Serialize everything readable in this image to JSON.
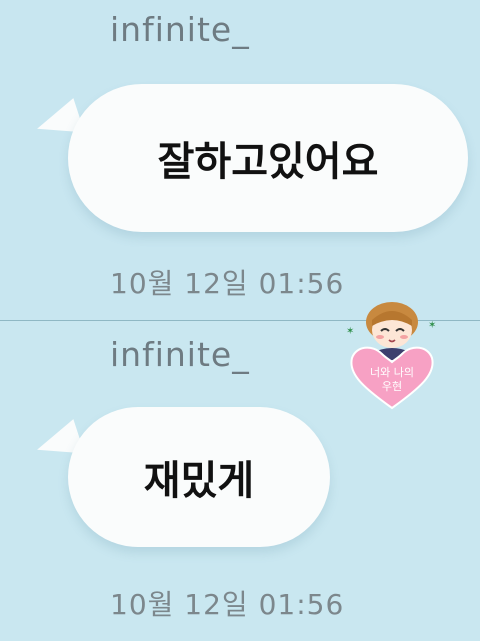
{
  "messages": [
    {
      "sender": "infinite_",
      "text": "잘하고있어요",
      "time": "10월 12일 01:56"
    },
    {
      "sender": "infinite_",
      "text": "재밌게",
      "time": "10월 12일 01:56"
    }
  ],
  "sticker": {
    "text_line1": "너와 나의",
    "text_line2": "우현",
    "heart_color": "#f7a1c4",
    "icon": "heart-character-sticker"
  },
  "colors": {
    "background": "#c8e6f0",
    "bubble": "#fafcfc",
    "meta_text": "#7c878c"
  }
}
